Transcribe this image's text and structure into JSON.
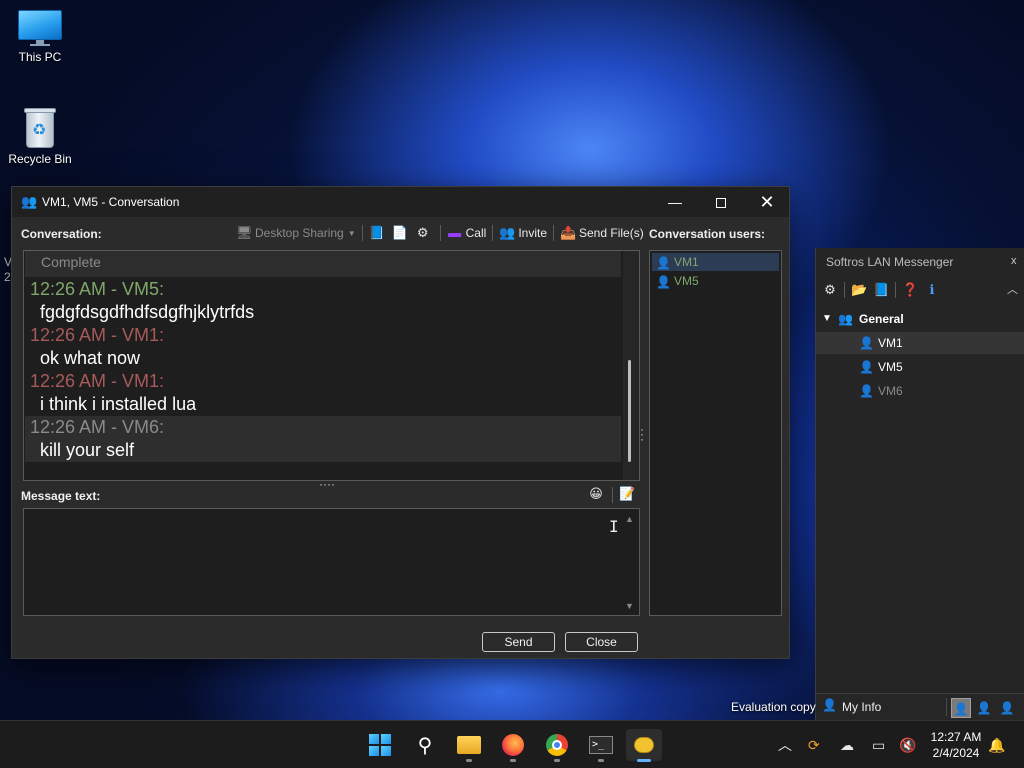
{
  "desktop": {
    "icons": [
      {
        "label": "This PC"
      },
      {
        "label": "Recycle Bin"
      }
    ],
    "partial_texts": [
      "V",
      "2"
    ],
    "watermark": "Evaluation copy"
  },
  "conversation_window": {
    "title": "VM1, VM5 - Conversation",
    "conversation_label": "Conversation:",
    "toolbar": {
      "desktop_sharing": "Desktop Sharing",
      "call": "Call",
      "invite": "Invite",
      "send_files": "Send File(s)"
    },
    "status": "Complete",
    "messages": [
      {
        "header": "12:26 AM - VM5:",
        "text": "fgdgfdsgdfhdfsdgfhjklytrfds",
        "color": "#7fa86a"
      },
      {
        "header": "12:26 AM - VM1:",
        "text": "ok what now",
        "color": "#a85a5a"
      },
      {
        "header": "12:26 AM - VM1:",
        "text": "i think i installed lua",
        "color": "#a85a5a"
      },
      {
        "header": "12:26 AM - VM6:",
        "text": "kill your self",
        "color": "#8a8a8a"
      }
    ],
    "message_text_label": "Message text:",
    "message_value": "",
    "users_label": "Conversation users:",
    "users": [
      {
        "name": "VM1",
        "color": "#7fa86a",
        "selected": true
      },
      {
        "name": "VM5",
        "color": "#7fa86a",
        "selected": false
      }
    ],
    "send_button": "Send",
    "close_button": "Close",
    "window_controls": {
      "minimize": "—",
      "close": "✕"
    }
  },
  "messenger_panel": {
    "title": "Softros LAN Messenger",
    "close": "x",
    "group": "General",
    "users": [
      {
        "name": "VM1",
        "color": "#ffffff",
        "selected": true
      },
      {
        "name": "VM5",
        "color": "#ffffff",
        "selected": false
      },
      {
        "name": "VM6",
        "color": "#8a8a8a",
        "selected": false
      }
    ],
    "my_info": "My Info"
  },
  "taskbar": {
    "apps": [
      "start-icon",
      "search-icon",
      "file-explorer-icon",
      "firefox-icon",
      "chrome-icon",
      "terminal-icon",
      "softros-messenger-icon"
    ],
    "clock_time": "12:27 AM",
    "clock_date": "2/4/2024"
  }
}
